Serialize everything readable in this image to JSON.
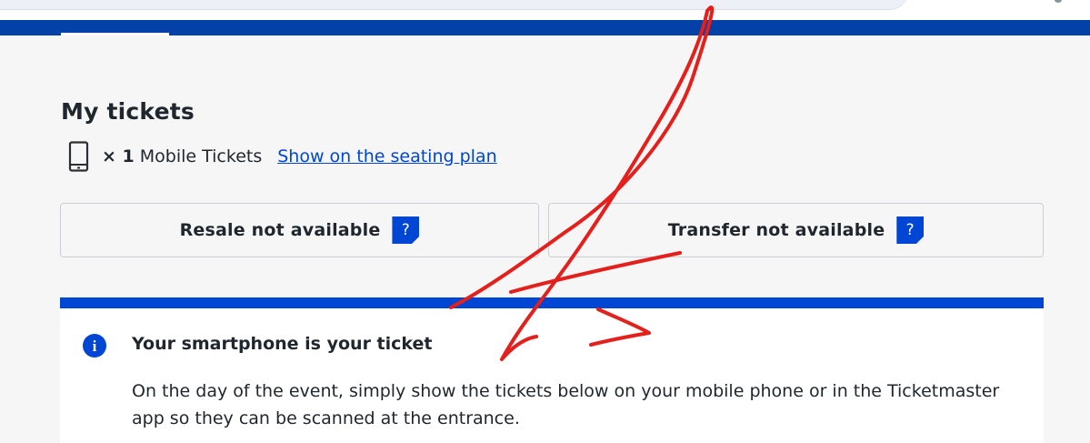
{
  "tickets": {
    "heading": "My tickets",
    "quantity": "× 1",
    "type": "Mobile Tickets",
    "seating_link": "Show on the seating plan"
  },
  "actions": {
    "resale": {
      "label": "Resale not available",
      "help": "?"
    },
    "transfer": {
      "label": "Transfer not available",
      "help": "?"
    }
  },
  "info": {
    "icon_letter": "i",
    "title": "Your smartphone is your ticket",
    "body": "On the day of the event, simply show the tickets below on your mobile phone or in the Ticketmaster app so they can be scanned at the entrance."
  },
  "colors": {
    "brand_blue": "#0046d5",
    "nav_blue": "#0340a8",
    "scribble_red": "#e3201b"
  },
  "icons": [
    "smartphone-icon",
    "help-icon",
    "info-icon"
  ]
}
